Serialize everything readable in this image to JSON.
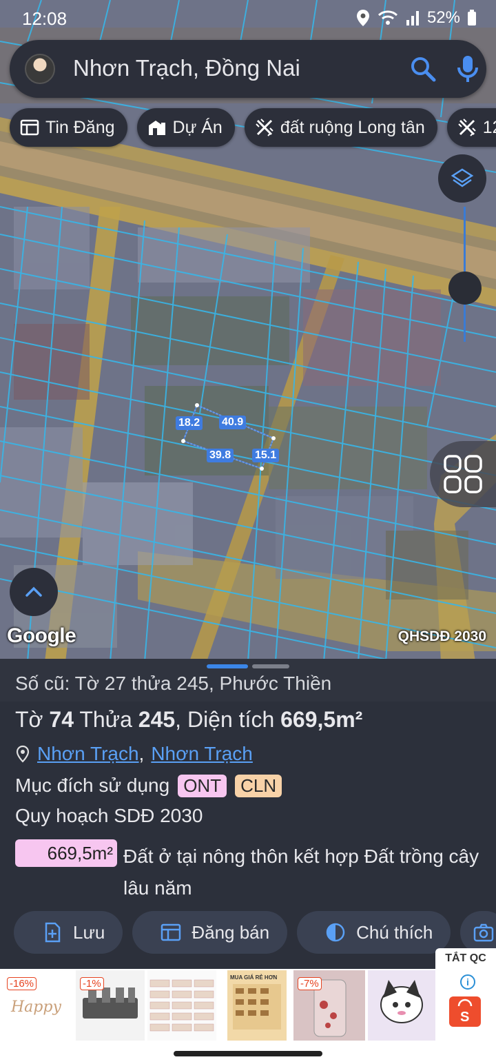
{
  "status_bar": {
    "time": "12:08",
    "battery": "52%"
  },
  "search": {
    "query": "Nhơn Trạch, Đồng Nai"
  },
  "chips": [
    {
      "label": "Tin Đăng",
      "icon": "listing-icon"
    },
    {
      "label": "Dự Án",
      "icon": "project-icon"
    },
    {
      "label": "đất ruộng Long tân",
      "icon": "ruler-icon"
    },
    {
      "label": "12",
      "icon": "ruler-icon"
    }
  ],
  "map": {
    "dimensions": [
      "18.2",
      "40.9",
      "39.8",
      "15.1"
    ],
    "google_label": "Google",
    "layer_label": "QHSDĐ 2030"
  },
  "parcel": {
    "old_ref": "Số cũ: Tờ 27 thửa 245, Phước Thiền",
    "sheet_prefix": "Tờ ",
    "sheet_no": "74",
    "parcel_prefix": " Thửa ",
    "parcel_no": "245",
    "area_prefix": ", Diện tích ",
    "area": "669,5m²",
    "location_1": "Nhơn Trạch",
    "location_sep": ",",
    "location_2": "Nhơn Trạch",
    "purpose_label": "Mục đích sử dụng",
    "purpose_tags": [
      "ONT",
      "CLN"
    ],
    "plan_title": "Quy hoạch SDĐ 2030",
    "plan_area": "669,5m²",
    "plan_desc": "Đất ở tại nông thôn kết hợp Đất trồng cây lâu năm"
  },
  "actions": [
    {
      "label": "Lưu",
      "icon": "save-icon"
    },
    {
      "label": "Đăng bán",
      "icon": "post-sale-icon"
    },
    {
      "label": "Chú thích",
      "icon": "legend-icon"
    },
    {
      "label": "",
      "icon": "camera-icon"
    }
  ],
  "ads": {
    "close_label": "TẮT QC",
    "discounts": [
      "-16%",
      "-1%",
      "-7%"
    ],
    "promo_title": "MUA GIÁ RẺ HƠN"
  },
  "colors": {
    "accent": "#3b86e8",
    "sheet_bg": "#2c303b",
    "tag_ont": "#f7c6f0",
    "tag_cln": "#f8d2a8"
  }
}
